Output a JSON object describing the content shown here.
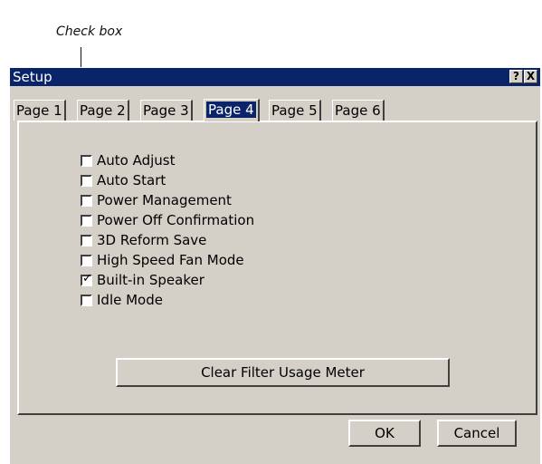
{
  "callout": {
    "label": "Check box"
  },
  "window": {
    "title": "Setup",
    "help_glyph": "?",
    "close_glyph": "X"
  },
  "tabs": [
    {
      "label": "Page 1",
      "active": false
    },
    {
      "label": "Page 2",
      "active": false
    },
    {
      "label": "Page 3",
      "active": false
    },
    {
      "label": "Page 4",
      "active": true
    },
    {
      "label": "Page 5",
      "active": false
    },
    {
      "label": "Page 6",
      "active": false
    }
  ],
  "checkboxes": [
    {
      "label": "Auto Adjust",
      "checked": false
    },
    {
      "label": "Auto Start",
      "checked": false
    },
    {
      "label": "Power Management",
      "checked": false
    },
    {
      "label": "Power Off Confirmation",
      "checked": false
    },
    {
      "label": "3D Reform Save",
      "checked": false
    },
    {
      "label": "High Speed Fan Mode",
      "checked": false
    },
    {
      "label": "Built-in Speaker",
      "checked": true
    },
    {
      "label": "Idle Mode",
      "checked": false
    }
  ],
  "buttons": {
    "clear_filter": "Clear Filter Usage Meter",
    "ok": "OK",
    "cancel": "Cancel"
  },
  "colors": {
    "titlebar": "#0a246a",
    "face": "#d4d0c8"
  }
}
